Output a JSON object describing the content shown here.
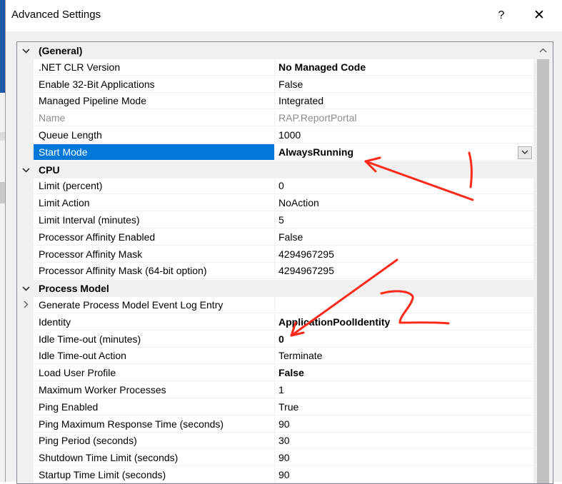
{
  "window": {
    "title": "Advanced Settings",
    "help_label": "?",
    "close_label": "✕"
  },
  "groups": [
    {
      "label": "(General)",
      "rows": [
        {
          "name": ".NET CLR Version",
          "value": "No Managed Code",
          "bold": true
        },
        {
          "name": "Enable 32-Bit Applications",
          "value": "False"
        },
        {
          "name": "Managed Pipeline Mode",
          "value": "Integrated"
        },
        {
          "name": "Name",
          "value": "RAP.ReportPortal",
          "disabled": true
        },
        {
          "name": "Queue Length",
          "value": "1000"
        },
        {
          "name": "Start Mode",
          "value": "AlwaysRunning",
          "bold": true,
          "selected": true,
          "dropdown": true
        }
      ]
    },
    {
      "label": "CPU",
      "rows": [
        {
          "name": "Limit (percent)",
          "value": "0"
        },
        {
          "name": "Limit Action",
          "value": "NoAction"
        },
        {
          "name": "Limit Interval (minutes)",
          "value": "5"
        },
        {
          "name": "Processor Affinity Enabled",
          "value": "False"
        },
        {
          "name": "Processor Affinity Mask",
          "value": "4294967295"
        },
        {
          "name": "Processor Affinity Mask (64-bit option)",
          "value": "4294967295"
        }
      ]
    },
    {
      "label": "Process Model",
      "rows": [
        {
          "name": "Generate Process Model Event Log Entry",
          "value": "",
          "expandable": true
        },
        {
          "name": "Identity",
          "value": "ApplicationPoolIdentity",
          "bold": true
        },
        {
          "name": "Idle Time-out (minutes)",
          "value": "0",
          "bold": true
        },
        {
          "name": "Idle Time-out Action",
          "value": "Terminate"
        },
        {
          "name": "Load User Profile",
          "value": "False",
          "bold": true
        },
        {
          "name": "Maximum Worker Processes",
          "value": "1"
        },
        {
          "name": "Ping Enabled",
          "value": "True"
        },
        {
          "name": "Ping Maximum Response Time (seconds)",
          "value": "90"
        },
        {
          "name": "Ping Period (seconds)",
          "value": "30"
        },
        {
          "name": "Shutdown Time Limit (seconds)",
          "value": "90"
        },
        {
          "name": "Startup Time Limit (seconds)",
          "value": "90"
        }
      ]
    }
  ],
  "icons": {
    "expanded": "chevron-down-icon",
    "collapsed": "chevron-right-icon",
    "dropdown": "chevron-down-icon",
    "scroll_up": "chevron-up-icon"
  },
  "colors": {
    "selection": "#0078d7",
    "annotation": "#ff2a1a",
    "disabled_text": "#8d8d8d"
  }
}
